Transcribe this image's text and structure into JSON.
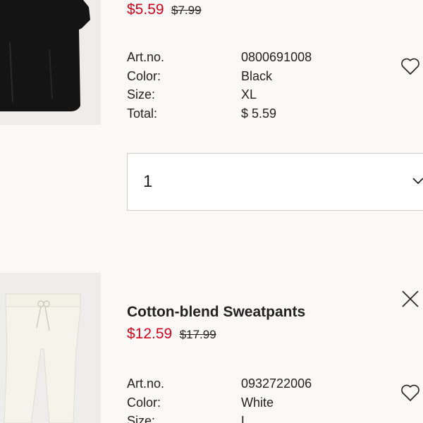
{
  "items": [
    {
      "title": "",
      "price_sale": "$5.59",
      "price_original": "$7.99",
      "image_alt": "Black t-shirt",
      "details": [
        {
          "label": "Art.no.",
          "value": "0800691008"
        },
        {
          "label": "Color:",
          "value": "Black"
        },
        {
          "label": "Size:",
          "value": "XL"
        },
        {
          "label": "Total:",
          "value": "$ 5.59"
        }
      ],
      "quantity": "1",
      "favorite_icon": "heart-outline-icon"
    },
    {
      "title": "Cotton-blend Sweatpants",
      "price_sale": "$12.59",
      "price_original": "$17.99",
      "image_alt": "White sweatpants",
      "details": [
        {
          "label": "Art.no.",
          "value": "0932722006"
        },
        {
          "label": "Color:",
          "value": "White"
        },
        {
          "label": "Size:",
          "value": "L"
        }
      ],
      "favorite_icon": "heart-outline-icon",
      "remove_icon": "close-icon"
    }
  ],
  "colors": {
    "sale_price": "#d0021b",
    "text": "#222222",
    "page_background": "#faf9f8",
    "thumbnail_background": "#efedeb"
  }
}
